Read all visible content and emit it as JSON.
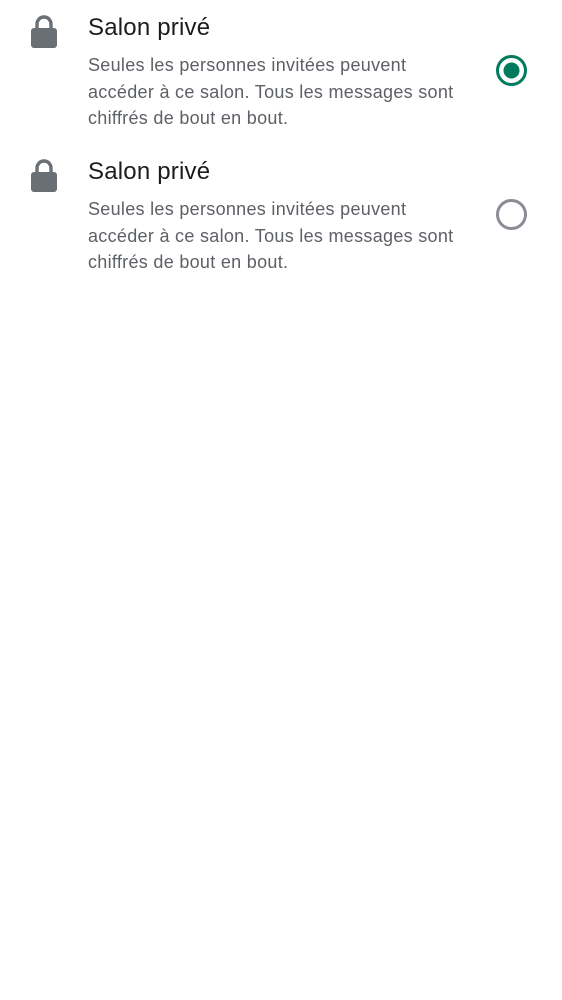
{
  "colors": {
    "accent": "#017a5e",
    "radio_unselected": "#8a8e94",
    "lock_icon": "#6a6f76",
    "title_text": "#1b1c1f",
    "description_text": "#5d6066",
    "background": "#ffffff"
  },
  "options": [
    {
      "icon": "lock-icon",
      "title": "Salon privé",
      "description": "Seules les personnes invitées peuvent accéder à ce salon. Tous les messages sont chiffrés de bout en bout.",
      "selected": true
    },
    {
      "icon": "lock-icon",
      "title": "Salon privé",
      "description": "Seules les personnes invitées peuvent accéder à ce salon. Tous les messages sont chiffrés de bout en bout.",
      "selected": false
    }
  ]
}
